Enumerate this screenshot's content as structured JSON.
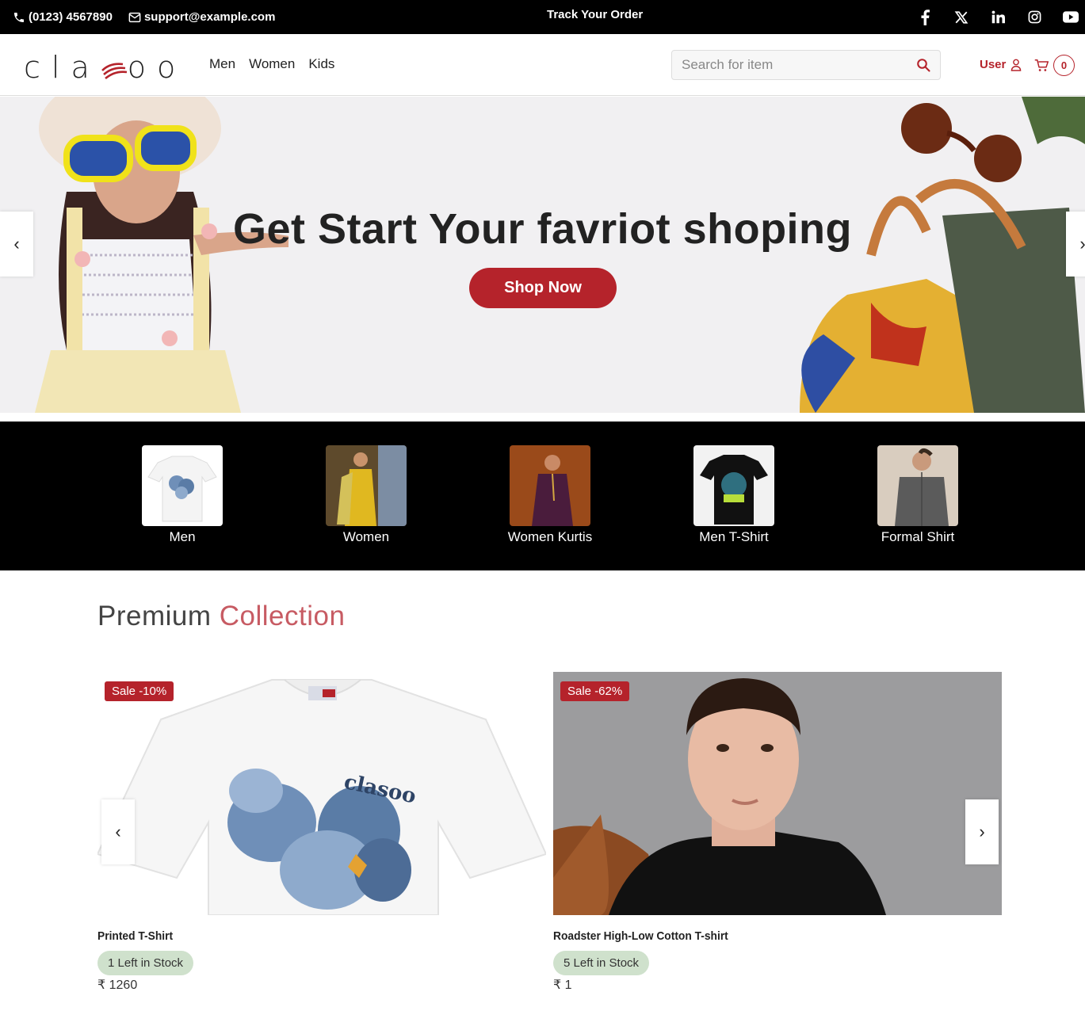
{
  "topbar": {
    "phone": "(0123) 4567890",
    "email": "support@example.com",
    "track_order": "Track Your Order",
    "socials": [
      "facebook-icon",
      "x-icon",
      "linkedin-icon",
      "instagram-icon",
      "youtube-icon"
    ]
  },
  "header": {
    "logo_text": "cla",
    "logo_text_end": "oo",
    "nav": [
      "Men",
      "Women",
      "Kids"
    ],
    "search_placeholder": "Search for item",
    "user_label": "User",
    "cart_count": "0"
  },
  "hero": {
    "headline": "Get Start Your favriot shoping",
    "cta": "Shop Now"
  },
  "categories": [
    {
      "label": "Men"
    },
    {
      "label": "Women"
    },
    {
      "label": "Women Kurtis"
    },
    {
      "label": "Men T-Shirt"
    },
    {
      "label": "Formal Shirt"
    }
  ],
  "collection": {
    "title_part1": "Premium",
    "title_part2": "Collection",
    "products": [
      {
        "sale": "Sale -10%",
        "name": "Printed T-Shirt",
        "stock": "1 Left in Stock",
        "price": "₹ 1260"
      },
      {
        "sale": "Sale -62%",
        "name": "Roadster High-Low Cotton T-shirt",
        "stock": "5 Left in Stock",
        "price": "₹ 1"
      }
    ]
  },
  "colors": {
    "accent": "#b5232b",
    "title_accent": "#c75b63",
    "stock_badge": "#cfe1cc"
  }
}
